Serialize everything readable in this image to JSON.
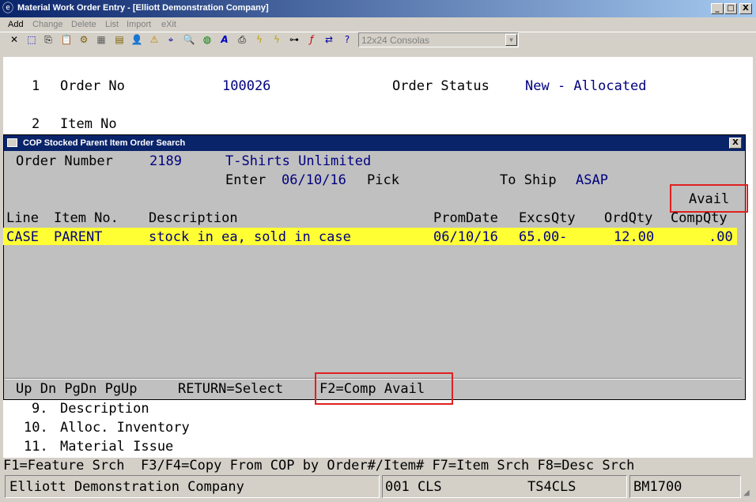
{
  "window": {
    "title": "Material Work Order Entry - [Elliott Demonstration Company]",
    "controls": {
      "minimize": "_",
      "maximize": "□",
      "close": "X"
    }
  },
  "menu": [
    {
      "label": "Add",
      "enabled": true
    },
    {
      "label": "Change",
      "enabled": false
    },
    {
      "label": "Delete",
      "enabled": false
    },
    {
      "label": "List",
      "enabled": false
    },
    {
      "label": "Import",
      "enabled": false
    },
    {
      "label": "eXit",
      "enabled": false
    }
  ],
  "toolbar": {
    "font_select": "12x24 Consolas",
    "icons": [
      "close-icon",
      "select-icon",
      "copy-icon",
      "paste-icon",
      "settings-icon",
      "properties-icon",
      "notes-icon",
      "user-add-icon",
      "warning-icon",
      "binoculars-icon",
      "zoom-icon",
      "globe-icon",
      "font-icon",
      "print-icon",
      "lightning-icon",
      "lightning-doc-icon",
      "link-icon",
      "function-icon",
      "arrows-icon",
      "document-icon",
      "help-icon"
    ]
  },
  "form": {
    "order_no": {
      "num": "1",
      "label": "Order No",
      "value": "100026"
    },
    "order_status": {
      "label": "Order Status",
      "value": "New - Allocated"
    },
    "item_no": {
      "num": "2",
      "label": "Item No"
    },
    "fields_below": [
      {
        "num": "9.",
        "label": "Description"
      },
      {
        "num": "10.",
        "label": "Alloc. Inventory"
      },
      {
        "num": "11.",
        "label": "Material Issue"
      }
    ]
  },
  "popup": {
    "title": "COP Stocked Parent Item Order Search",
    "order_number_label": "Order Number",
    "order_number": "2189",
    "customer": "T-Shirts Unlimited",
    "enter_label": "Enter",
    "enter_date": "06/10/16",
    "pick_label": "Pick",
    "to_ship_label": "To Ship",
    "to_ship": "ASAP",
    "avail_label": "Avail",
    "columns": [
      "Line",
      "Item No.",
      "Description",
      "PromDate",
      "ExcsQty",
      "OrdQty",
      "CompQty"
    ],
    "rows": [
      {
        "line": "CASE",
        "item": "PARENT",
        "description": "stock in ea, sold in case",
        "promdate": "06/10/16",
        "excsqty": "65.00-",
        "ordqty": "12.00",
        "compqty": ".00"
      }
    ],
    "footer": {
      "nav": "Up Dn PgDn PgUp",
      "return": "RETURN=Select",
      "f2": "F2=Comp Avail"
    }
  },
  "function_keys": "F1=Feature Srch  F3/F4=Copy From COP by Order#/Item# F7=Item Srch F8=Desc Srch",
  "status": {
    "company": "Elliott Demonstration Company",
    "user": "001 CLS",
    "terminal": "TS4CLS",
    "program": "BM1700"
  },
  "colors": {
    "title_bar": "#0a246a",
    "highlight_row": "#ffff33",
    "value_text": "#000080",
    "callout_box": "#e02020"
  }
}
